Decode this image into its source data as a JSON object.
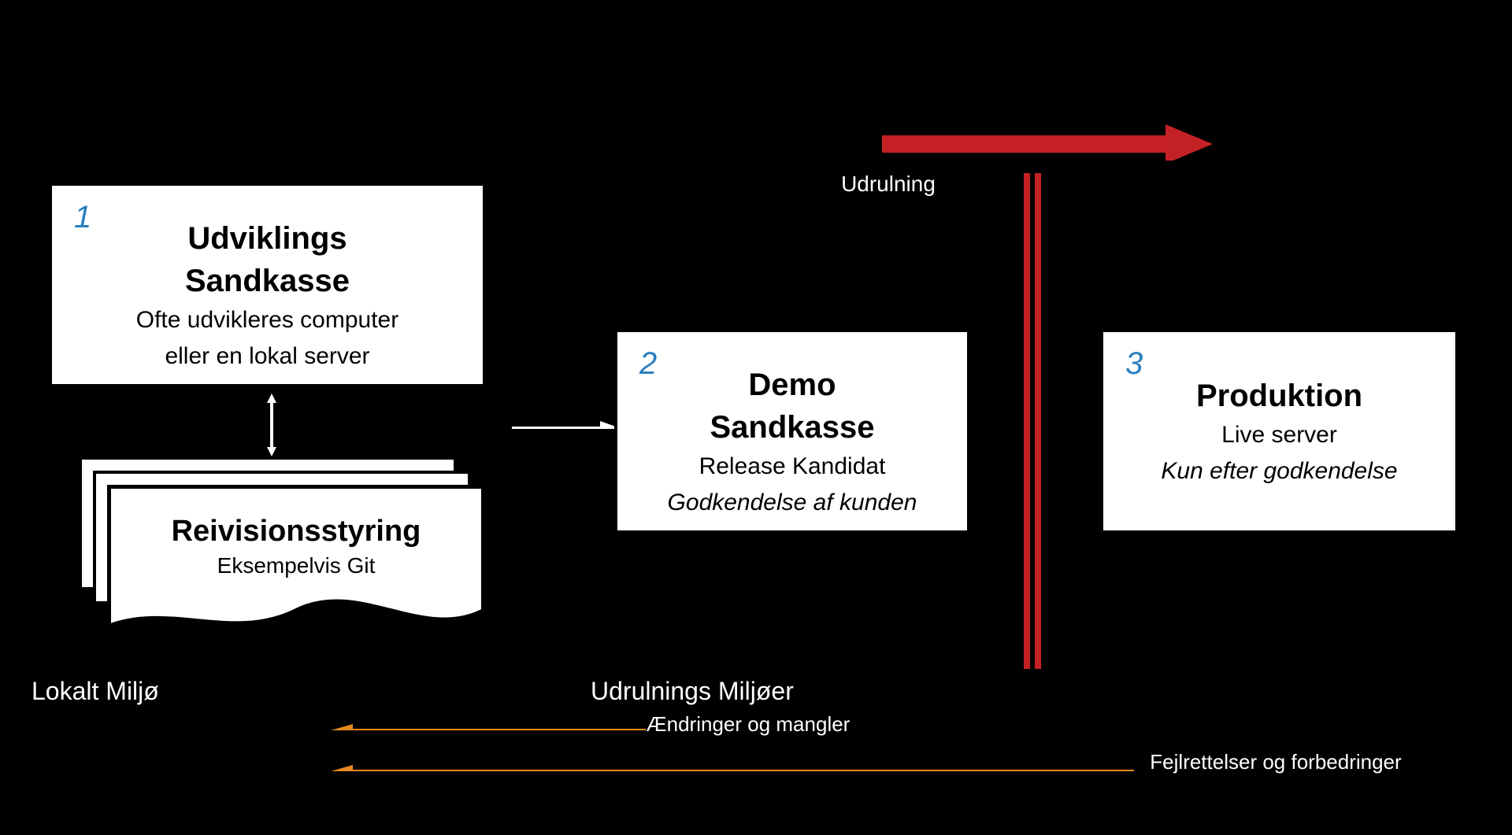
{
  "boxes": {
    "b1": {
      "num": "1",
      "title_l1": "Udviklings",
      "title_l2": "Sandkasse",
      "sub_l1": "Ofte udvikleres computer",
      "sub_l2": "eller en lokal server"
    },
    "b2": {
      "num": "2",
      "title_l1": "Demo",
      "title_l2": "Sandkasse",
      "sub_l1": "Release Kandidat",
      "sub_l2_italic": "Godkendelse af kunden"
    },
    "b3": {
      "num": "3",
      "title_l1": "Produktion",
      "sub_l1": "Live server",
      "sub_l2_italic": "Kun efter godkendelse"
    }
  },
  "revision": {
    "title": "Reivisionsstyring",
    "sub": "Eksempelvis Git"
  },
  "frames": {
    "local": "Lokalt Miljø",
    "deploy": "Udrulnings Miljøer"
  },
  "arrows": {
    "deploy_label": "Udrulning",
    "feedback_short": "Ændringer og mangler",
    "feedback_long": "Fejlrettelser og forbedringer"
  },
  "colors": {
    "red": "#c42127",
    "orange": "#e58a1f",
    "blue": "#2a7fbf"
  }
}
